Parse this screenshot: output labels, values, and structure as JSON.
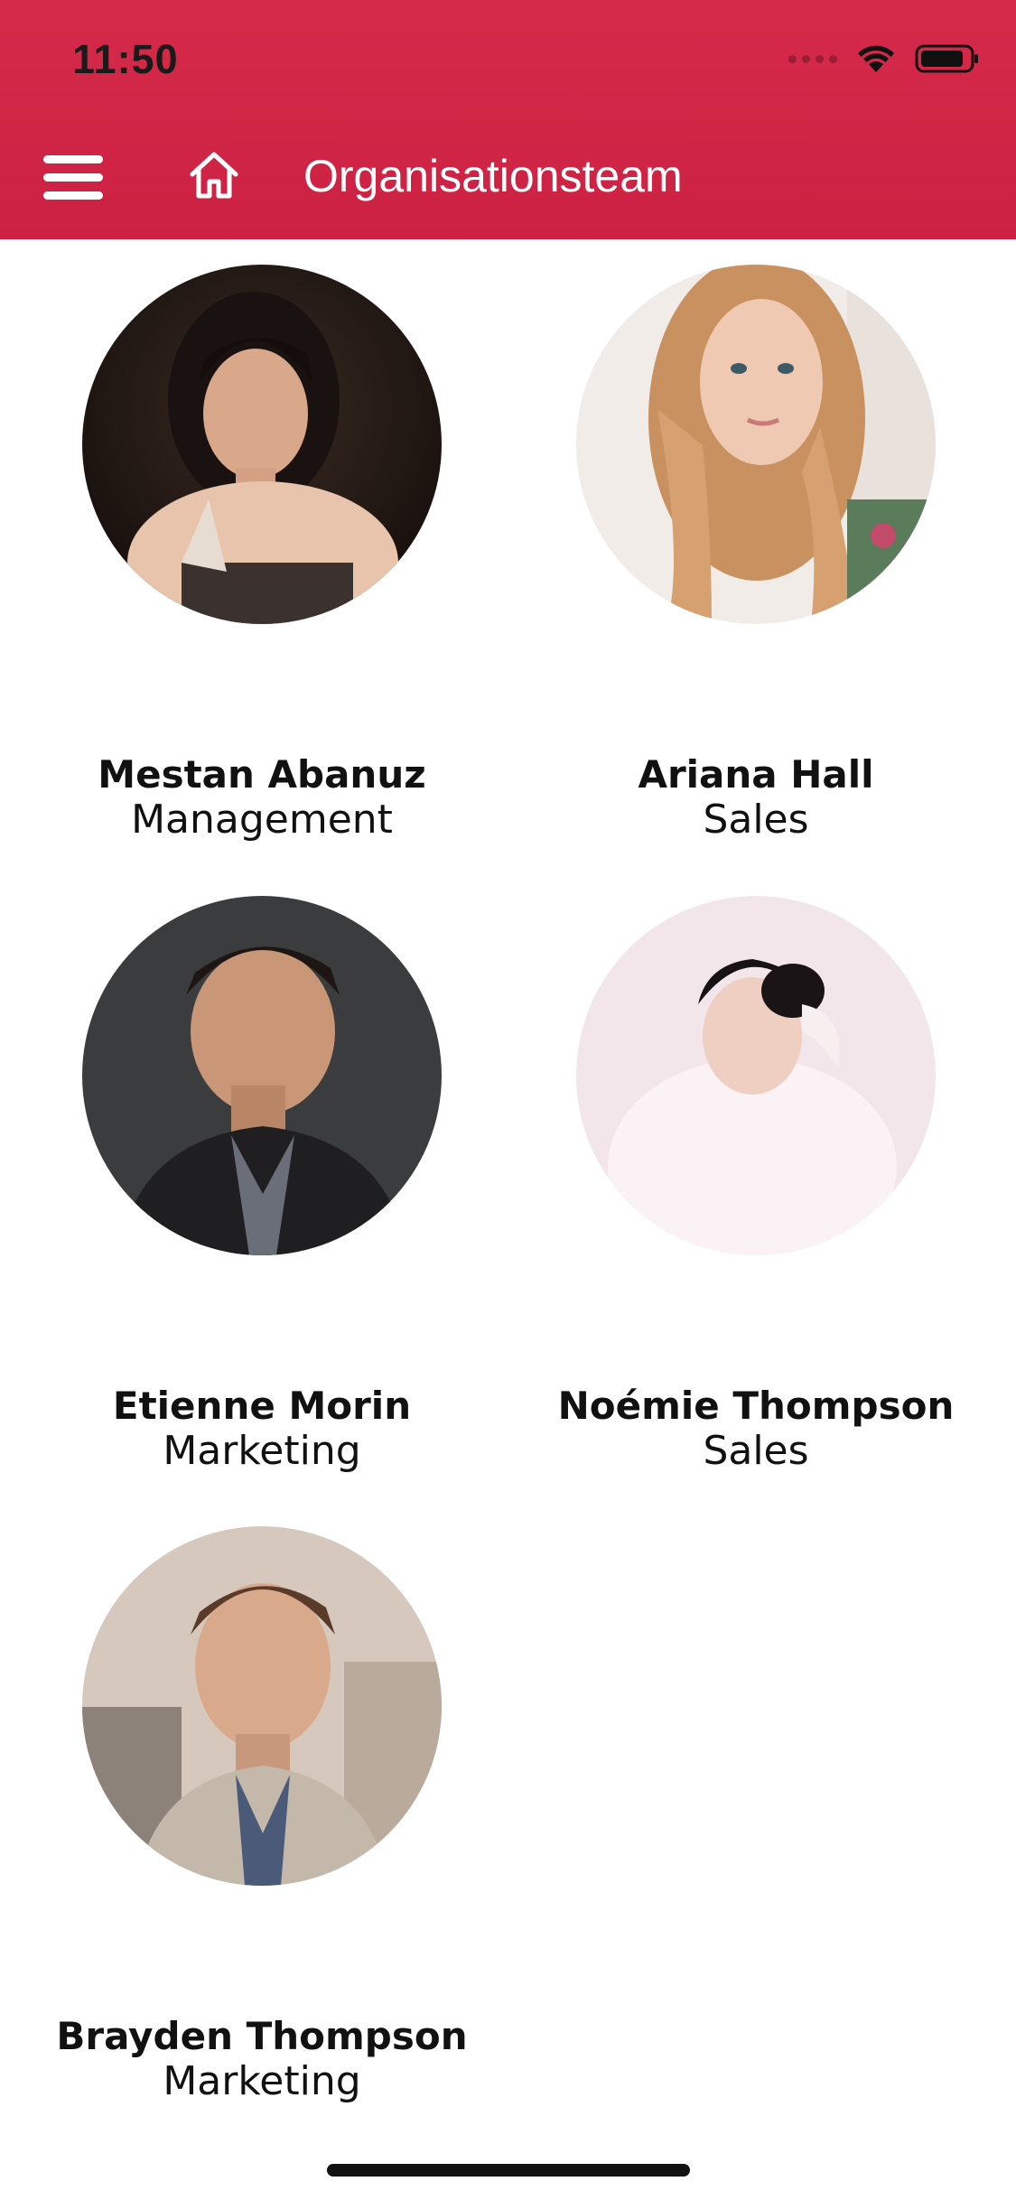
{
  "status_bar": {
    "time": "11:50",
    "icons": [
      "cellular-icon",
      "wifi-icon",
      "battery-icon"
    ]
  },
  "header": {
    "title": "Organisationsteam",
    "icons": [
      "menu-icon",
      "home-icon"
    ],
    "color": "#d62a4b"
  },
  "team": [
    {
      "name": "Mestan Abanuz",
      "department": "Management"
    },
    {
      "name": "Ariana Hall",
      "department": "Sales"
    },
    {
      "name": "Etienne Morin",
      "department": "Marketing"
    },
    {
      "name": "Noémie Thompson",
      "department": "Sales"
    },
    {
      "name": "Brayden Thompson",
      "department": "Marketing"
    }
  ]
}
